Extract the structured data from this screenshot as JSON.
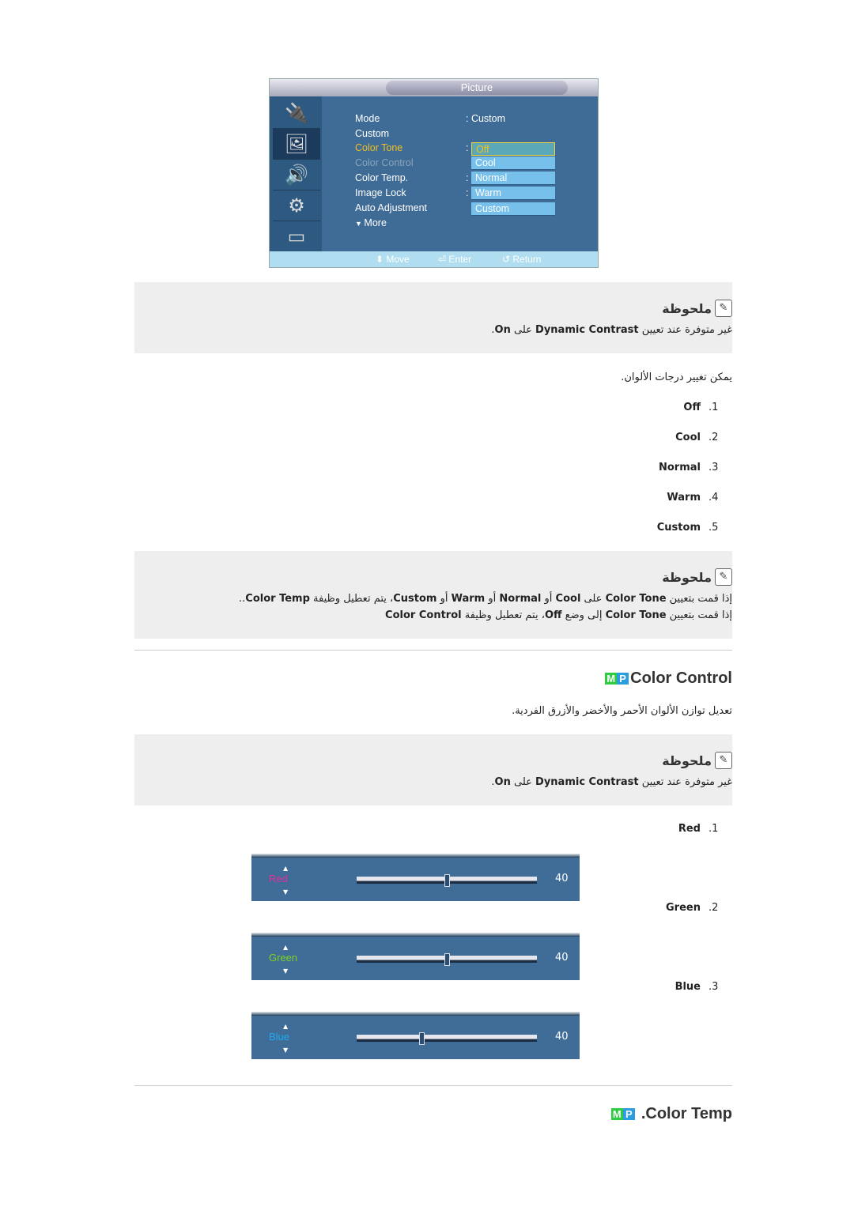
{
  "osd": {
    "title": "Picture",
    "side_icons": [
      "input-icon",
      "picture-icon",
      "sound-icon",
      "setup-icon",
      "multi-control-icon"
    ],
    "items": [
      "Mode",
      "Custom",
      "Color Tone",
      "Color Control",
      "Color Temp.",
      "Image Lock",
      "Auto Adjustment",
      "More"
    ],
    "mode_value": ": Custom",
    "highlight_color": "#f0c020",
    "disabled_color": "#8aa4bc",
    "dropdown": [
      "Off",
      "Cool",
      "Normal",
      "Warm",
      "Custom"
    ],
    "hints": {
      "move": "Move",
      "enter": "Enter",
      "return": "Return"
    }
  },
  "note_title": "ملحوظة",
  "note1": [
    "غير متوفرة عند تعيين ",
    "Dynamic Contrast",
    " على ",
    "On",
    "."
  ],
  "intro": "يمكن تغيير درجات الألوان.",
  "list1": [
    {
      "n": ".1",
      "t": "Off"
    },
    {
      "n": ".2",
      "t": "Cool"
    },
    {
      "n": ".3",
      "t": "Normal"
    },
    {
      "n": ".4",
      "t": "Warm"
    },
    {
      "n": ".5",
      "t": "Custom"
    }
  ],
  "note2_l1": [
    "إذا قمت بتعيين ",
    "Color Tone",
    " على ",
    "Cool",
    " أو ",
    "Normal",
    " أو ",
    "Warm",
    " أو ",
    "Custom",
    "، يتم تعطيل وظيفة ",
    "Color Temp",
    ".."
  ],
  "note2_l2": [
    "إذا قمت بتعيين ",
    "Color Tone",
    " إلى وضع ",
    "Off",
    "، يتم تعطيل وظيفة ",
    "Color Control"
  ],
  "mp_badge": [
    "M",
    "P"
  ],
  "section1": {
    "title": "Color Control",
    "desc": "تعديل توازن الألوان الأحمر والأخضر والأزرق الفردية."
  },
  "note3": [
    "غير متوفرة عند تعيين ",
    "Dynamic Contrast",
    " على ",
    "On",
    "."
  ],
  "list2": [
    {
      "n": ".1",
      "t": "Red"
    },
    {
      "n": ".2",
      "t": "Green"
    },
    {
      "n": ".3",
      "t": "Blue"
    }
  ],
  "sliders": [
    {
      "label": "Red",
      "value": "40",
      "level": 0.5,
      "color": "#e0309a"
    },
    {
      "label": "Green",
      "value": "40",
      "level": 0.5,
      "color": "#7ed321"
    },
    {
      "label": "Blue",
      "value": "40",
      "level": 0.36,
      "color": "#20a8f0"
    }
  ],
  "section2": {
    "title": ".Color Temp"
  }
}
